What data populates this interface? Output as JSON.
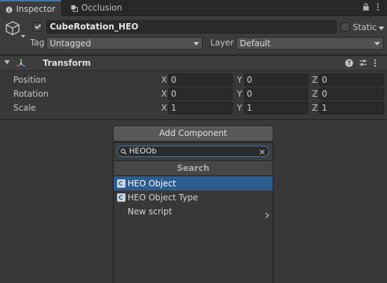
{
  "tabs": [
    {
      "label": "Inspector",
      "icon": "info-icon"
    },
    {
      "label": "Occlusion",
      "icon": "occlusion-icon"
    }
  ],
  "tab_actions": {
    "lock": "lock-icon",
    "menu": "more-vert-icon"
  },
  "object": {
    "name": "CubeRotation_HEO",
    "active": true,
    "static_label": "Static",
    "static_checked": false,
    "tag_label": "Tag",
    "tag_value": "Untagged",
    "layer_label": "Layer",
    "layer_value": "Default"
  },
  "component": {
    "title": "Transform",
    "expanded": true,
    "properties": [
      {
        "label": "Position",
        "x": "0",
        "y": "0",
        "z": "0"
      },
      {
        "label": "Rotation",
        "x": "0",
        "y": "0",
        "z": "0"
      },
      {
        "label": "Scale",
        "x": "1",
        "y": "1",
        "z": "1"
      }
    ],
    "axis_labels": {
      "x": "X",
      "y": "Y",
      "z": "Z"
    }
  },
  "add_component": {
    "button_label": "Add Component",
    "search_value": "HEOOb",
    "section_title": "Search",
    "results": [
      {
        "label": "HEO Object",
        "selected": true
      },
      {
        "label": "HEO Object Type",
        "selected": false
      },
      {
        "label": "New script",
        "selected": false,
        "has_submenu": true
      }
    ]
  },
  "colors": {
    "accent": "#3a79bb",
    "selection": "#2d5c8f",
    "panel": "#383838"
  }
}
